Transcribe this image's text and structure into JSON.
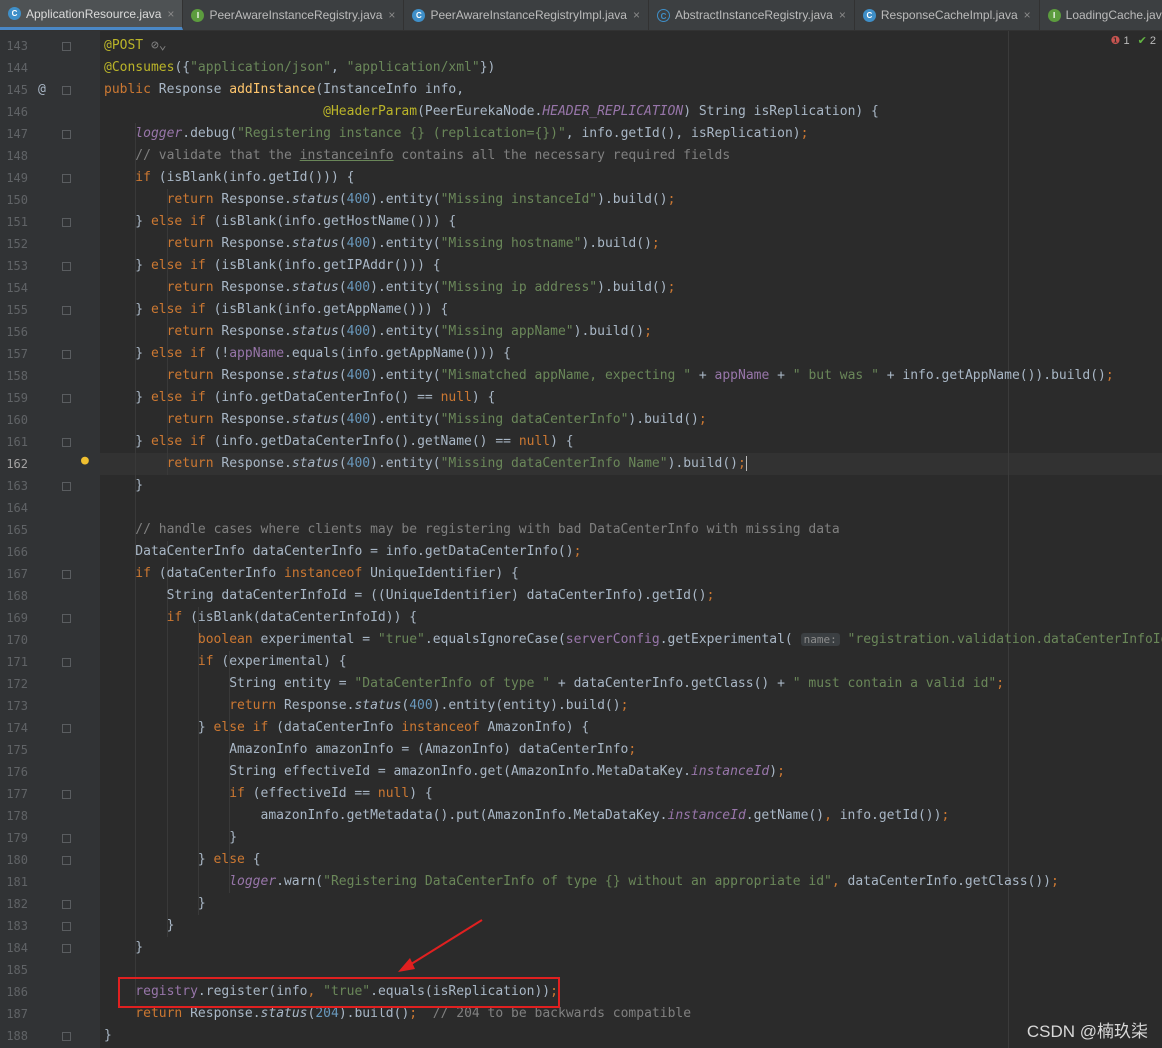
{
  "tabs": [
    {
      "label": "ApplicationResource.java",
      "kind": "c",
      "active": true
    },
    {
      "label": "PeerAwareInstanceRegistry.java",
      "kind": "i",
      "active": false
    },
    {
      "label": "PeerAwareInstanceRegistryImpl.java",
      "kind": "c",
      "active": false
    },
    {
      "label": "AbstractInstanceRegistry.java",
      "kind": "a",
      "active": false
    },
    {
      "label": "ResponseCacheImpl.java",
      "kind": "c",
      "active": false
    },
    {
      "label": "LoadingCache.java",
      "kind": "i",
      "active": false
    }
  ],
  "tab_close_glyph": "×",
  "indicators": {
    "errors": "1",
    "warnings": "2"
  },
  "current_line": "162",
  "watermark": "CSDN @楠玖柒",
  "colors": {
    "background": "#2b2b2b",
    "keyword": "#cc7832",
    "string": "#6a8759",
    "number": "#6897bb",
    "method": "#ffc66d",
    "annotation": "#bbb529",
    "field": "#9876aa",
    "comment": "#808080",
    "highlight_box": "#e02020"
  },
  "code": [
    {
      "n": "143",
      "ind": 0,
      "t": [
        [
          "an",
          "@POST"
        ],
        [
          "c",
          " ⊘⌄"
        ]
      ]
    },
    {
      "n": "144",
      "ind": 0,
      "t": [
        [
          "an",
          "@Consumes"
        ],
        [
          "",
          "({"
        ],
        [
          "s",
          "\"application/json\""
        ],
        [
          "",
          ", "
        ],
        [
          "s",
          "\"application/xml\""
        ],
        [
          "",
          "})"
        ]
      ]
    },
    {
      "n": "145",
      "ind": 0,
      "t": [
        [
          "k",
          "public "
        ],
        [
          "",
          "Response "
        ],
        [
          "m",
          "addInstance"
        ],
        [
          "",
          "(InstanceInfo info,"
        ]
      ]
    },
    {
      "n": "146",
      "ind": 0,
      "t": [
        [
          "",
          "                            "
        ],
        [
          "an",
          "@HeaderParam"
        ],
        [
          "",
          "(PeerEurekaNode."
        ],
        [
          "fi",
          "HEADER_REPLICATION"
        ],
        [
          "",
          ") String isReplication) {"
        ]
      ]
    },
    {
      "n": "147",
      "ind": 1,
      "t": [
        [
          "fi",
          "logger"
        ],
        [
          "",
          ".debug("
        ],
        [
          "s",
          "\"Registering instance {} (replication={})\""
        ],
        [
          "",
          ", info.getId(), isReplication)"
        ],
        [
          "k",
          ";"
        ]
      ]
    },
    {
      "n": "148",
      "ind": 1,
      "t": [
        [
          "c",
          "// validate that the "
        ],
        [
          "c u",
          "instanceinfo"
        ],
        [
          "c",
          " contains all the necessary required fields"
        ]
      ]
    },
    {
      "n": "149",
      "ind": 1,
      "t": [
        [
          "k",
          "if "
        ],
        [
          "",
          "(isBlank(info.getId())) {"
        ]
      ]
    },
    {
      "n": "150",
      "ind": 2,
      "t": [
        [
          "k",
          "return "
        ],
        [
          "",
          "Response."
        ],
        [
          "it",
          "status"
        ],
        [
          "",
          "("
        ],
        [
          "n",
          "400"
        ],
        [
          "",
          ").entity("
        ],
        [
          "s",
          "\"Missing instanceId\""
        ],
        [
          "",
          ").build()"
        ],
        [
          "k",
          ";"
        ]
      ]
    },
    {
      "n": "151",
      "ind": 1,
      "t": [
        [
          "",
          "} "
        ],
        [
          "k",
          "else if "
        ],
        [
          "",
          "(isBlank(info.getHostName())) {"
        ]
      ]
    },
    {
      "n": "152",
      "ind": 2,
      "t": [
        [
          "k",
          "return "
        ],
        [
          "",
          "Response."
        ],
        [
          "it",
          "status"
        ],
        [
          "",
          "("
        ],
        [
          "n",
          "400"
        ],
        [
          "",
          ").entity("
        ],
        [
          "s",
          "\"Missing hostname\""
        ],
        [
          "",
          ").build()"
        ],
        [
          "k",
          ";"
        ]
      ]
    },
    {
      "n": "153",
      "ind": 1,
      "t": [
        [
          "",
          "} "
        ],
        [
          "k",
          "else if "
        ],
        [
          "",
          "(isBlank(info.getIPAddr())) {"
        ]
      ]
    },
    {
      "n": "154",
      "ind": 2,
      "t": [
        [
          "k",
          "return "
        ],
        [
          "",
          "Response."
        ],
        [
          "it",
          "status"
        ],
        [
          "",
          "("
        ],
        [
          "n",
          "400"
        ],
        [
          "",
          ").entity("
        ],
        [
          "s",
          "\"Missing ip address\""
        ],
        [
          "",
          ").build()"
        ],
        [
          "k",
          ";"
        ]
      ]
    },
    {
      "n": "155",
      "ind": 1,
      "t": [
        [
          "",
          "} "
        ],
        [
          "k",
          "else if "
        ],
        [
          "",
          "(isBlank(info.getAppName())) {"
        ]
      ]
    },
    {
      "n": "156",
      "ind": 2,
      "t": [
        [
          "k",
          "return "
        ],
        [
          "",
          "Response."
        ],
        [
          "it",
          "status"
        ],
        [
          "",
          "("
        ],
        [
          "n",
          "400"
        ],
        [
          "",
          ").entity("
        ],
        [
          "s",
          "\"Missing appName\""
        ],
        [
          "",
          ").build()"
        ],
        [
          "k",
          ";"
        ]
      ]
    },
    {
      "n": "157",
      "ind": 1,
      "t": [
        [
          "",
          "} "
        ],
        [
          "k",
          "else if "
        ],
        [
          "",
          "(!"
        ],
        [
          "f",
          "appName"
        ],
        [
          "",
          ".equals(info.getAppName())) {"
        ]
      ]
    },
    {
      "n": "158",
      "ind": 2,
      "t": [
        [
          "k",
          "return "
        ],
        [
          "",
          "Response."
        ],
        [
          "it",
          "status"
        ],
        [
          "",
          "("
        ],
        [
          "n",
          "400"
        ],
        [
          "",
          ").entity("
        ],
        [
          "s",
          "\"Mismatched appName, expecting \""
        ],
        [
          "",
          " + "
        ],
        [
          "f",
          "appName"
        ],
        [
          "",
          " + "
        ],
        [
          "s",
          "\" but was \""
        ],
        [
          "",
          " + info.getAppName()).build()"
        ],
        [
          "k",
          ";"
        ]
      ]
    },
    {
      "n": "159",
      "ind": 1,
      "t": [
        [
          "",
          "} "
        ],
        [
          "k",
          "else if "
        ],
        [
          "",
          "(info.getDataCenterInfo() == "
        ],
        [
          "k",
          "null"
        ],
        [
          "",
          ") {"
        ]
      ]
    },
    {
      "n": "160",
      "ind": 2,
      "t": [
        [
          "k",
          "return "
        ],
        [
          "",
          "Response."
        ],
        [
          "it",
          "status"
        ],
        [
          "",
          "("
        ],
        [
          "n",
          "400"
        ],
        [
          "",
          ").entity("
        ],
        [
          "s",
          "\"Missing dataCenterInfo\""
        ],
        [
          "",
          ").build()"
        ],
        [
          "k",
          ";"
        ]
      ]
    },
    {
      "n": "161",
      "ind": 1,
      "t": [
        [
          "",
          "} "
        ],
        [
          "k",
          "else if "
        ],
        [
          "",
          "(info.getDataCenterInfo().getName() == "
        ],
        [
          "k",
          "null"
        ],
        [
          "",
          ") {"
        ]
      ]
    },
    {
      "n": "162",
      "ind": 2,
      "t": [
        [
          "k",
          "return "
        ],
        [
          "",
          "Response."
        ],
        [
          "it",
          "status"
        ],
        [
          "",
          "("
        ],
        [
          "n",
          "400"
        ],
        [
          "",
          ").entity("
        ],
        [
          "s",
          "\"Missing dataCenterInfo Name\""
        ],
        [
          "",
          ").build()"
        ],
        [
          "k",
          ";"
        ]
      ]
    },
    {
      "n": "163",
      "ind": 1,
      "t": [
        [
          "",
          "}"
        ]
      ]
    },
    {
      "n": "164",
      "ind": 0,
      "t": []
    },
    {
      "n": "165",
      "ind": 1,
      "t": [
        [
          "c",
          "// handle cases where clients may be registering with bad DataCenterInfo with missing data"
        ]
      ]
    },
    {
      "n": "166",
      "ind": 1,
      "t": [
        [
          "",
          "DataCenterInfo dataCenterInfo = info.getDataCenterInfo()"
        ],
        [
          "k",
          ";"
        ]
      ]
    },
    {
      "n": "167",
      "ind": 1,
      "t": [
        [
          "k",
          "if "
        ],
        [
          "",
          "(dataCenterInfo "
        ],
        [
          "k",
          "instanceof "
        ],
        [
          "",
          "UniqueIdentifier) {"
        ]
      ]
    },
    {
      "n": "168",
      "ind": 2,
      "t": [
        [
          "",
          "String dataCenterInfoId = ((UniqueIdentifier) dataCenterInfo).getId()"
        ],
        [
          "k",
          ";"
        ]
      ]
    },
    {
      "n": "169",
      "ind": 2,
      "t": [
        [
          "k",
          "if "
        ],
        [
          "",
          "(isBlank(dataCenterInfoId)) {"
        ]
      ]
    },
    {
      "n": "170",
      "ind": 3,
      "t": [
        [
          "k",
          "boolean "
        ],
        [
          "",
          "experimental = "
        ],
        [
          "s",
          "\"true\""
        ],
        [
          "",
          ".equalsIgnoreCase("
        ],
        [
          "f",
          "serverConfig"
        ],
        [
          "",
          ".getExperimental( "
        ],
        [
          "hint",
          "name:"
        ],
        [
          "",
          ""
        ],
        [
          "s",
          " \"registration.validation.dataCenterInfoId\""
        ]
      ]
    },
    {
      "n": "171",
      "ind": 3,
      "t": [
        [
          "k",
          "if "
        ],
        [
          "",
          "(experimental) {"
        ]
      ]
    },
    {
      "n": "172",
      "ind": 4,
      "t": [
        [
          "",
          "String entity = "
        ],
        [
          "s",
          "\"DataCenterInfo of type \""
        ],
        [
          "",
          " + dataCenterInfo.getClass() + "
        ],
        [
          "s",
          "\" must contain a valid id\""
        ],
        [
          "k",
          ";"
        ]
      ]
    },
    {
      "n": "173",
      "ind": 4,
      "t": [
        [
          "k",
          "return "
        ],
        [
          "",
          "Response."
        ],
        [
          "it",
          "status"
        ],
        [
          "",
          "("
        ],
        [
          "n",
          "400"
        ],
        [
          "",
          ").entity(entity).build()"
        ],
        [
          "k",
          ";"
        ]
      ]
    },
    {
      "n": "174",
      "ind": 3,
      "t": [
        [
          "",
          "} "
        ],
        [
          "k",
          "else if "
        ],
        [
          "",
          "(dataCenterInfo "
        ],
        [
          "k",
          "instanceof "
        ],
        [
          "",
          "AmazonInfo) {"
        ]
      ]
    },
    {
      "n": "175",
      "ind": 4,
      "t": [
        [
          "",
          "AmazonInfo amazonInfo = (AmazonInfo) dataCenterInfo"
        ],
        [
          "k",
          ";"
        ]
      ]
    },
    {
      "n": "176",
      "ind": 4,
      "t": [
        [
          "",
          "String effectiveId = amazonInfo.get(AmazonInfo.MetaDataKey."
        ],
        [
          "fi",
          "instanceId"
        ],
        [
          "",
          ")"
        ],
        [
          "k",
          ";"
        ]
      ]
    },
    {
      "n": "177",
      "ind": 4,
      "t": [
        [
          "k",
          "if "
        ],
        [
          "",
          "(effectiveId == "
        ],
        [
          "k",
          "null"
        ],
        [
          "",
          ") {"
        ]
      ]
    },
    {
      "n": "178",
      "ind": 5,
      "t": [
        [
          "",
          "amazonInfo.getMetadata().put(AmazonInfo.MetaDataKey."
        ],
        [
          "fi",
          "instanceId"
        ],
        [
          "",
          ".getName()"
        ],
        [
          "k",
          ", "
        ],
        [
          "",
          "info.getId())"
        ],
        [
          "k",
          ";"
        ]
      ]
    },
    {
      "n": "179",
      "ind": 4,
      "t": [
        [
          "",
          "}"
        ]
      ]
    },
    {
      "n": "180",
      "ind": 3,
      "t": [
        [
          "",
          "} "
        ],
        [
          "k",
          "else "
        ],
        [
          "",
          "{"
        ]
      ]
    },
    {
      "n": "181",
      "ind": 4,
      "t": [
        [
          "fi",
          "logger"
        ],
        [
          "",
          ".warn("
        ],
        [
          "s",
          "\"Registering DataCenterInfo of type {} without an appropriate id\""
        ],
        [
          "k",
          ", "
        ],
        [
          "",
          "dataCenterInfo.getClass())"
        ],
        [
          "k",
          ";"
        ]
      ]
    },
    {
      "n": "182",
      "ind": 3,
      "t": [
        [
          "",
          "}"
        ]
      ]
    },
    {
      "n": "183",
      "ind": 2,
      "t": [
        [
          "",
          "}"
        ]
      ]
    },
    {
      "n": "184",
      "ind": 1,
      "t": [
        [
          "",
          "}"
        ]
      ]
    },
    {
      "n": "185",
      "ind": 0,
      "t": []
    },
    {
      "n": "186",
      "ind": 1,
      "t": [
        [
          "f",
          "registry"
        ],
        [
          "",
          ".register(info"
        ],
        [
          "k",
          ", "
        ],
        [
          "s",
          "\"true\""
        ],
        [
          "",
          ".equals(isReplication))"
        ],
        [
          "k",
          ";"
        ]
      ]
    },
    {
      "n": "187",
      "ind": 1,
      "t": [
        [
          "k",
          "return "
        ],
        [
          "",
          "Response."
        ],
        [
          "it",
          "status"
        ],
        [
          "",
          "("
        ],
        [
          "n",
          "204"
        ],
        [
          "",
          ").build()"
        ],
        [
          "k",
          ";  "
        ],
        [
          "c",
          "// 204 to be backwards compatible"
        ]
      ]
    },
    {
      "n": "188",
      "ind": 0,
      "t": [
        [
          "",
          "}"
        ]
      ]
    }
  ]
}
